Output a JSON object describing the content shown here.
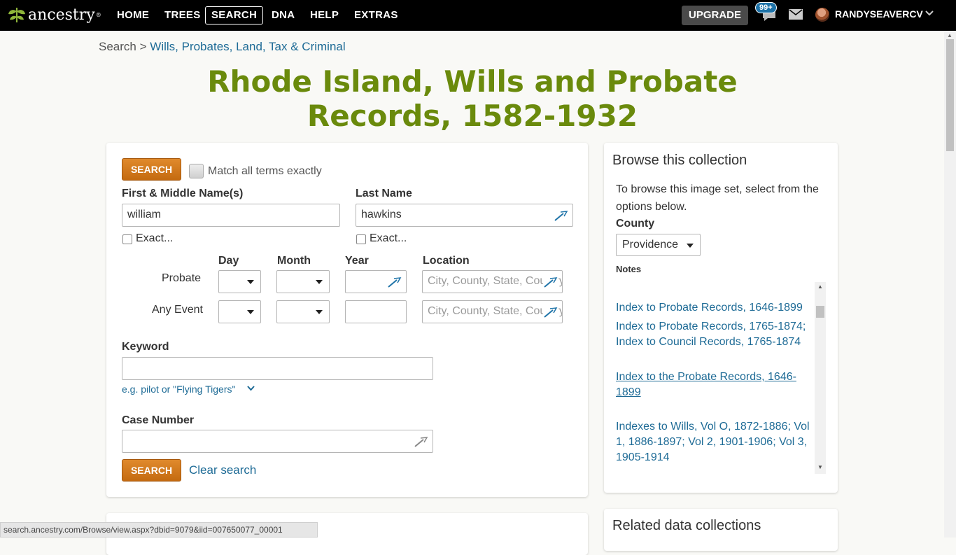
{
  "nav": {
    "logo": "ancestry",
    "items": [
      "HOME",
      "TREES",
      "SEARCH",
      "DNA",
      "HELP",
      "EXTRAS"
    ],
    "upgrade": "UPGRADE",
    "hints_badge": "99+",
    "username": "RANDYSEAVERCV"
  },
  "breadcrumb": {
    "root": "Search",
    "sep": ">",
    "category": "Wills, Probates, Land, Tax & Criminal"
  },
  "title": {
    "line1": "Rhode Island, Wills and Probate",
    "line2": "Records, 1582-1932"
  },
  "form": {
    "search_label": "SEARCH",
    "match_exact": "Match all terms exactly",
    "first_name_label": "First & Middle Name(s)",
    "first_name_value": "william",
    "last_name_label": "Last Name",
    "last_name_value": "hawkins",
    "exact_label": "Exact...",
    "col_day": "Day",
    "col_month": "Month",
    "col_year": "Year",
    "col_location": "Location",
    "row_probate": "Probate",
    "row_any_event": "Any Event",
    "location_placeholder": "City, County, State, Country",
    "keyword_label": "Keyword",
    "keyword_hint": "e.g. pilot or \"Flying Tigers\"",
    "case_label": "Case Number",
    "clear_search": "Clear search"
  },
  "browse": {
    "heading": "Browse this collection",
    "intro": "To browse this image set, select from the options below.",
    "county_label": "County",
    "county_value": "Providence",
    "notes_label": "Notes",
    "notes": [
      "Index to Probate Records, 1646-1899",
      "Index to Probate Records, 1765-1874; Index to Council Records, 1765-1874",
      "Index to the Probate Records, 1646-1899",
      "Indexes to Wills, Vol O, 1872-1886; Vol 1, 1886-1897; Vol 2, 1901-1906; Vol 3, 1905-1914"
    ]
  },
  "related": {
    "heading": "Related data collections"
  },
  "status_url": "search.ancestry.com/Browse/view.aspx?dbid=9079&iid=007650077_00001"
}
